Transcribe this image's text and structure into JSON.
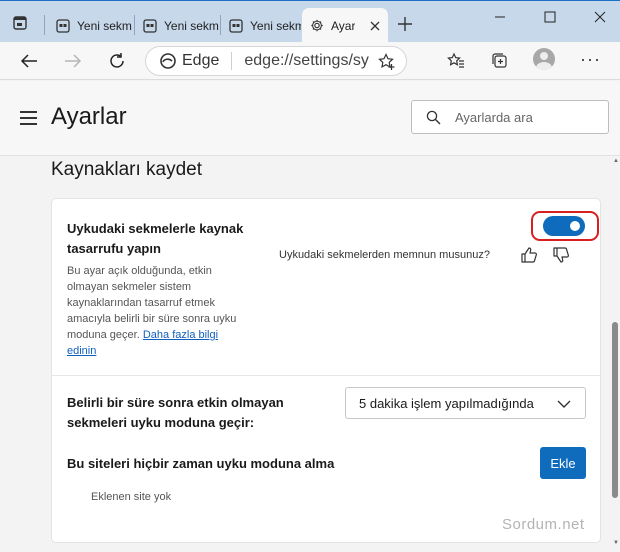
{
  "tabs": [
    {
      "label": "Yeni sekme"
    },
    {
      "label": "Yeni sekme"
    },
    {
      "label": "Yeni sekme"
    },
    {
      "label": "Ayarlar"
    }
  ],
  "toolbar": {
    "address_prefix": "Edge",
    "address_url": "edge://settings/system"
  },
  "header": {
    "title": "Ayarlar",
    "search_placeholder": "Ayarlarda ara"
  },
  "section": {
    "title": "Kaynakları kaydet"
  },
  "sleeping_tabs": {
    "title": "Uykudaki sekmelerle kaynak tasarrufu yapın",
    "description": "Bu ayar açık olduğunda, etkin olmayan sekmeler sistem kaynaklarından tasarruf etmek amacıyla belirli bir süre sonra uyku moduna geçer.",
    "learn_more": "Daha fazla bilgi edinin",
    "feedback_question": "Uykudaki sekmelerden memnun musunuz?",
    "enabled": true
  },
  "inactive": {
    "title": "Belirli bir süre sonra etkin olmayan sekmeleri uyku moduna geçir:",
    "selected": "5 dakika işlem yapılmadığında"
  },
  "never_sleep": {
    "title": "Bu siteleri hiçbir zaman uyku moduna alma",
    "add_label": "Ekle",
    "empty_text": "Eklenen site yok"
  },
  "watermark": "Sordum.net",
  "colors": {
    "accent": "#0f6cbd",
    "highlight_ring": "#d92020",
    "titlebar": "#c6d8ea"
  }
}
